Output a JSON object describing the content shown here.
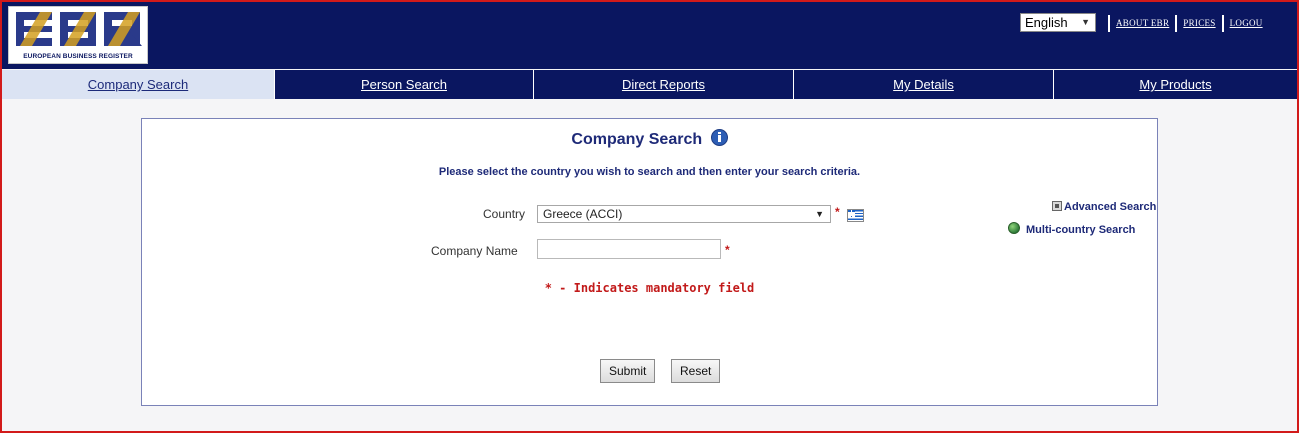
{
  "header": {
    "logo_text": "EUROPEAN BUSINESS REGISTER",
    "language": "English",
    "links": [
      {
        "label": "ABOUT EBR"
      },
      {
        "label": "PRICES"
      },
      {
        "label": "LOGOU"
      }
    ]
  },
  "tabs": [
    {
      "label": "Company Search"
    },
    {
      "label": "Person Search"
    },
    {
      "label": "Direct Reports"
    },
    {
      "label": "My Details"
    },
    {
      "label": "My Products"
    }
  ],
  "form": {
    "title": "Company Search",
    "instruction": "Please select the country you wish to search and then enter your search criteria.",
    "country_label": "Country",
    "country_value": "Greece (ACCI)",
    "company_name_label": "Company Name",
    "company_name_value": "",
    "required_mark": "*",
    "mandatory_note": "* - Indicates mandatory field",
    "advanced_search": "Advanced Search",
    "multi_country_search": "Multi-country Search",
    "submit_label": "Submit",
    "reset_label": "Reset"
  },
  "colors": {
    "navy": "#0a1660",
    "active_tab": "#dbe3f3",
    "heading": "#1e2a78",
    "required": "#c21a1a",
    "frame_border": "#d21a1a"
  },
  "icons": [
    "info-icon",
    "greece-flag-icon",
    "advanced-search-icon",
    "globe-icon",
    "dropdown-arrow-icon"
  ]
}
